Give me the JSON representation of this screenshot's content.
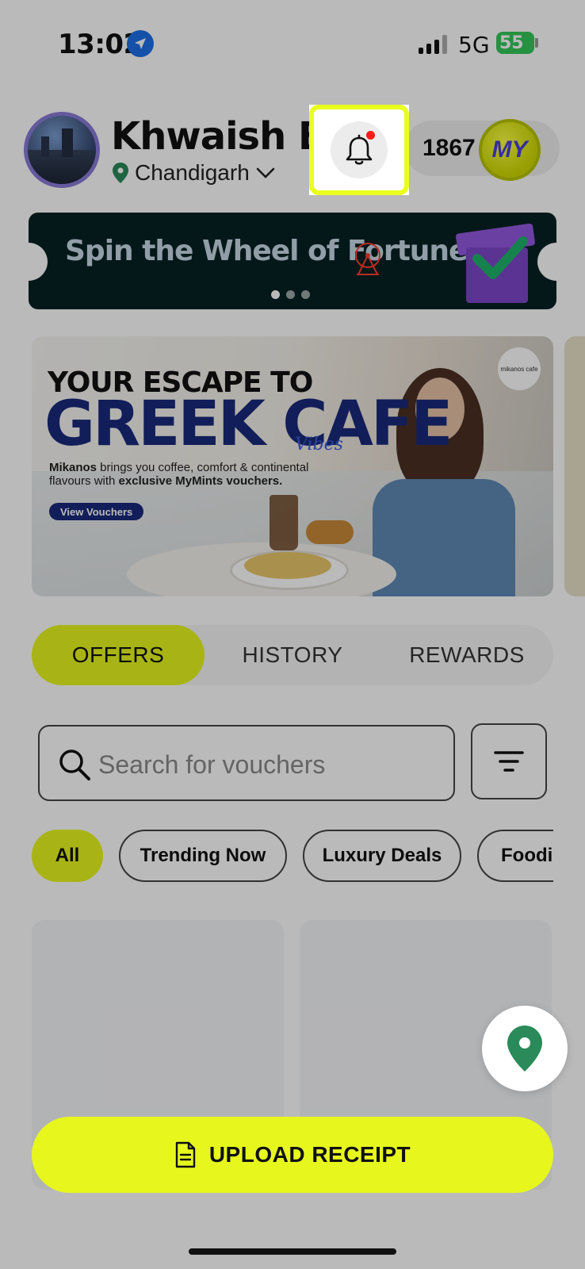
{
  "status_bar": {
    "time": "13:02",
    "network": "5G",
    "battery": "55"
  },
  "header": {
    "user_name": "Khwaish Bhasin",
    "location": "Chandigarh",
    "coins": "1867",
    "coin_badge": "MY"
  },
  "spin_banner": {
    "text": "Spin the Wheel of Fortune!"
  },
  "hero_banner": {
    "line1": "YOUR ESCAPE TO",
    "line2": "GREEK CAFE",
    "vibes": "Vibes",
    "brand": "Mikanos",
    "desc_part1": " brings you coffee, comfort & continental flavours with ",
    "desc_bold": "exclusive MyMints vouchers.",
    "button": "View Vouchers",
    "logo_text": "mikanos cafe"
  },
  "tabs": [
    {
      "label": "OFFERS",
      "active": true
    },
    {
      "label": "HISTORY",
      "active": false
    },
    {
      "label": "REWARDS",
      "active": false
    }
  ],
  "search": {
    "placeholder": "Search for vouchers"
  },
  "chips": [
    {
      "label": "All",
      "active": true
    },
    {
      "label": "Trending Now",
      "active": false
    },
    {
      "label": "Luxury Deals",
      "active": false
    },
    {
      "label": "Foodie",
      "active": false
    }
  ],
  "upload": {
    "label": "UPLOAD RECEIPT"
  },
  "colors": {
    "accent": "#e7f71e",
    "highlight": "#e9ff1f",
    "notification_dot": "#ff1a1a"
  }
}
